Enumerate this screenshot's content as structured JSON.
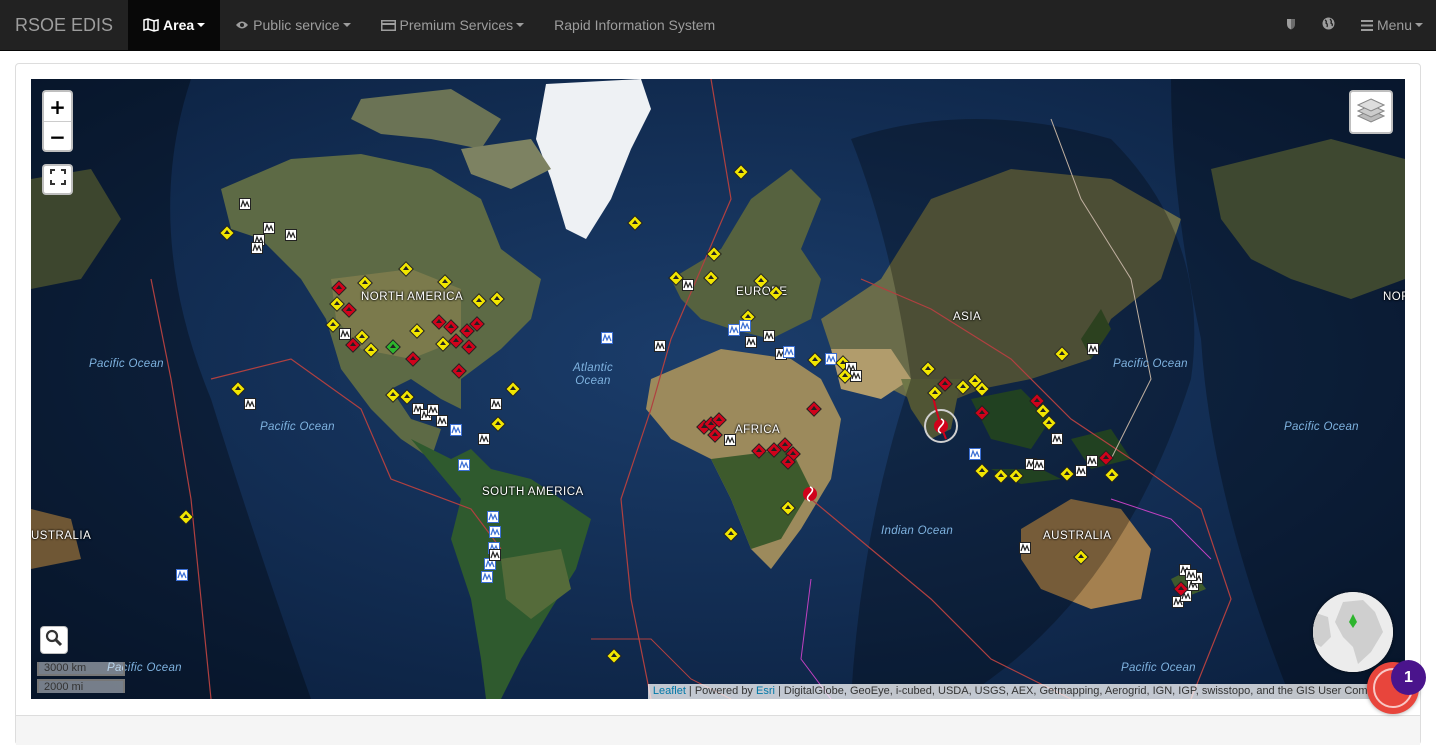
{
  "navbar": {
    "brand": "RSOE EDIS",
    "items": [
      {
        "label": "Area",
        "icon": "map-icon",
        "active": true,
        "caret": true
      },
      {
        "label": "Public service",
        "icon": "eye-icon",
        "active": false,
        "caret": true
      },
      {
        "label": "Premium Services",
        "icon": "credit-card-icon",
        "active": false,
        "caret": true
      },
      {
        "label": "Rapid Information System",
        "icon": "",
        "active": false,
        "caret": false
      }
    ],
    "right": {
      "shield_icon": "shield-icon",
      "globe_icon": "globe-icon",
      "menu_label": "Menu"
    }
  },
  "map": {
    "zoom_in": "+",
    "zoom_out": "−",
    "continents": [
      "NORTH AMERICA",
      "EUROPE",
      "ASIA",
      "AFRICA",
      "SOUTH AMERICA",
      "AUSTRALIA",
      "USTRALIA",
      "NOR"
    ],
    "oceans": [
      "Pacific Ocean",
      "Pacific Ocean",
      "Atlantic Ocean",
      "Pacific Ocean",
      "Pacific Ocean",
      "Indian Ocean",
      "Pacific Ocean",
      "Pacific Ocean",
      "Pacific Ocean"
    ],
    "scale_km": "3000 km",
    "scale_mi": "2000 mi",
    "attribution": {
      "leaflet": "Leaflet",
      "sep1": " | Powered by ",
      "esri": "Esri",
      "rest": " | DigitalGlobe, GeoEye, i-cubed, USDA, USGS, AEX, Getmapping, Aerogrid, IGN, IGP, swisstopo, and the GIS User Community"
    },
    "marker_colors": {
      "yellow": "#f2e600",
      "red": "#d0021b",
      "green": "#2db52d",
      "white": "#ffffff",
      "blue": "#3b6fd4"
    }
  },
  "chat": {
    "badge": "1",
    "colors": {
      "button": "#e8453c",
      "badge": "#4a148c"
    }
  }
}
